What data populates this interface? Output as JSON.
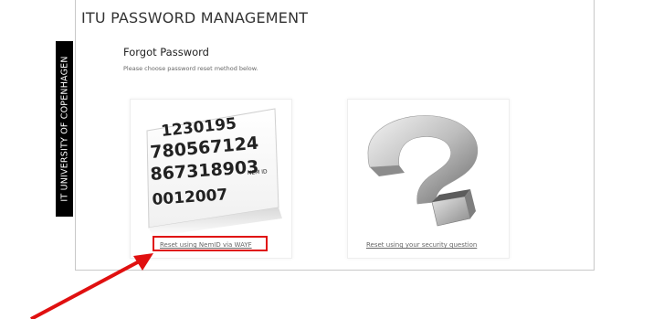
{
  "header": {
    "title": "ITU PASSWORD MANAGEMENT"
  },
  "sidebar": {
    "logo_text": "IT UNIVERSITY OF COPENHAGEN"
  },
  "main": {
    "heading": "Forgot Password",
    "instruction": "Please choose password reset method below.",
    "options": [
      {
        "link_label": "Reset using NemID via WAYF",
        "image": "nemid-card-image",
        "nemid_badge": "NEM ID"
      },
      {
        "link_label": "Reset using your security question",
        "image": "question-mark-image"
      }
    ]
  },
  "annotation": {
    "highlight_color": "#e01010",
    "arrow_color": "#e01010"
  }
}
